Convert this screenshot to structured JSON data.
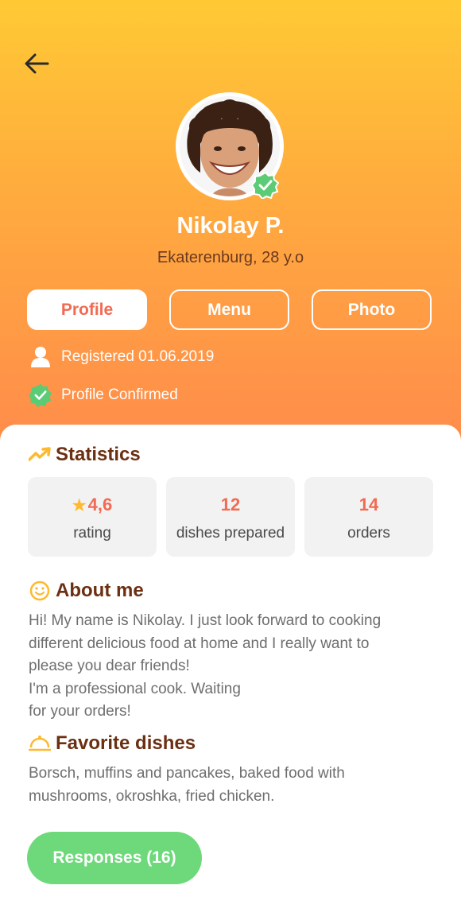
{
  "header": {
    "back_icon": "arrow-left-icon"
  },
  "profile": {
    "name": "Nikolay P.",
    "location": "Ekaterenburg, 28 y.o",
    "avatar_icon": "user-photo",
    "verified_icon": "verified-badge-icon"
  },
  "tabs": [
    {
      "label": "Profile",
      "active": true
    },
    {
      "label": "Menu",
      "active": false
    },
    {
      "label": "Photo",
      "active": false
    }
  ],
  "info": {
    "registered": "Registered 01.06.2019",
    "confirmed": "Profile Confirmed"
  },
  "statistics": {
    "title": "Statistics",
    "items": [
      {
        "value": "4,6",
        "label": "rating",
        "icon": "star-icon"
      },
      {
        "value": "12",
        "label": "dishes prepared"
      },
      {
        "value": "14",
        "label": "orders"
      }
    ]
  },
  "about": {
    "title": "About me",
    "lines": [
      "Hi! My name is Nikolay. I just look forward to cooking",
      "different delicious food at home and I really want to",
      "please you dear friends!",
      "I'm a professional cook. Waiting",
      "for your orders!"
    ]
  },
  "favorites": {
    "title": "Favorite dishes",
    "lines": [
      "Borsch,  muffins and pancakes, baked food with",
      "mushrooms, okroshka, fried chicken."
    ]
  },
  "responses_button": "Responses (16)",
  "colors": {
    "accent": "#F26A52",
    "brown": "#6B2F12",
    "green": "#6DD97A",
    "gradient_top": "#FFC934",
    "gradient_bottom": "#FF8A4C"
  }
}
